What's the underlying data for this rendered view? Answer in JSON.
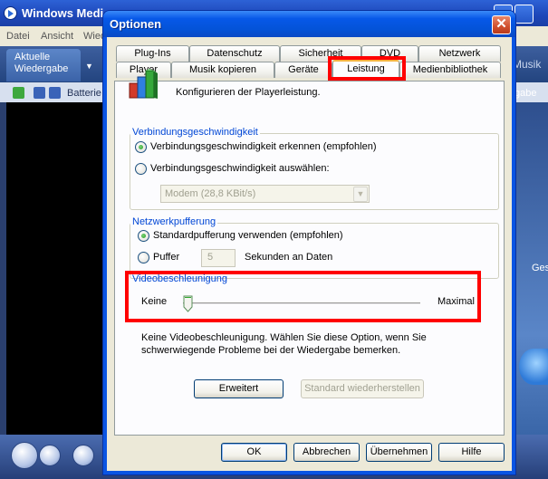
{
  "wmp": {
    "title": "Windows Medi",
    "menu": [
      "Datei",
      "Ansicht",
      "Wied"
    ],
    "nav_tab_line1": "Aktuelle",
    "nav_tab_line2": "Wiedergabe",
    "nav_right": "Musik",
    "toolbar_label": "Batterie",
    "toolbar_right": "gabe",
    "side_label": "Ges"
  },
  "dialog": {
    "title": "Optionen",
    "close_label": "✕",
    "tabs_row1": [
      "Plug-Ins",
      "Datenschutz",
      "Sicherheit",
      "DVD",
      "Netzwerk"
    ],
    "tabs_row2": [
      "Player",
      "Musik kopieren",
      "Geräte",
      "Leistung",
      "Medienbibliothek"
    ],
    "active_tab": "Leistung",
    "intro": "Konfigurieren der Playerleistung.",
    "connection": {
      "label": "Verbindungsgeschwindigkeit",
      "option_detect": "Verbindungsgeschwindigkeit erkennen (empfohlen)",
      "option_select": "Verbindungsgeschwindigkeit auswählen:",
      "selected": "detect",
      "speed_value": "Modem (28,8 KBit/s)"
    },
    "buffering": {
      "label": "Netzwerkpufferung",
      "option_default": "Standardpufferung verwenden (empfohlen)",
      "option_buffer": "Puffer",
      "buffer_value": "5",
      "buffer_suffix": "Sekunden an Daten",
      "selected": "default"
    },
    "video_acceleration": {
      "label": "Videobeschleunigung",
      "min_label": "Keine",
      "max_label": "Maximal",
      "level": 0,
      "description_line1": "Keine Videobeschleunigung. Wählen Sie diese Option, wenn Sie",
      "description_line2": "schwerwiegende Probleme bei der Wiedergabe bemerken."
    },
    "buttons": {
      "advanced": "Erweitert",
      "restore": "Standard wiederherstellen",
      "ok": "OK",
      "cancel": "Abbrechen",
      "apply": "Übernehmen",
      "help": "Hilfe"
    },
    "highlight_color": "#ff0000"
  }
}
